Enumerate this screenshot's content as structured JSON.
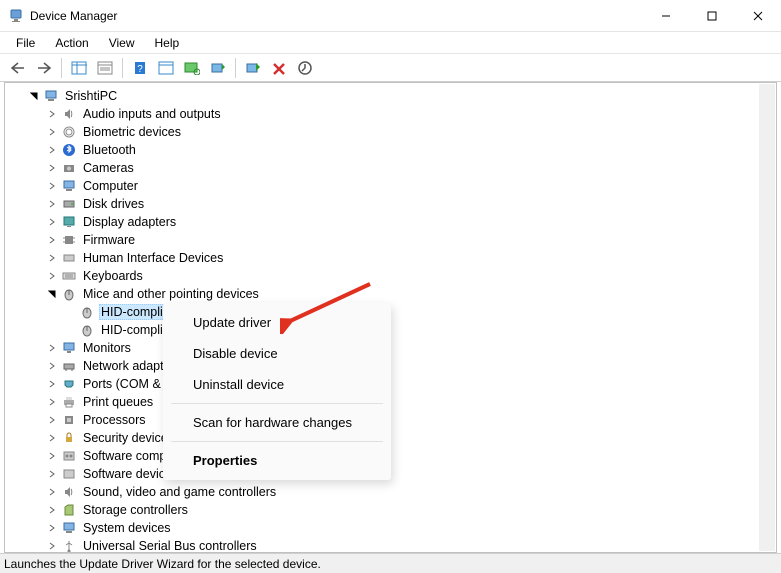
{
  "window": {
    "title": "Device Manager"
  },
  "menu": {
    "file": "File",
    "action": "Action",
    "view": "View",
    "help": "Help"
  },
  "tree": {
    "root": "SrishtiPC",
    "categories": [
      "Audio inputs and outputs",
      "Biometric devices",
      "Bluetooth",
      "Cameras",
      "Computer",
      "Disk drives",
      "Display adapters",
      "Firmware",
      "Human Interface Devices",
      "Keyboards",
      "Mice and other pointing devices",
      "Monitors",
      "Network adapters",
      "Ports (COM & LP",
      "Print queues",
      "Processors",
      "Security devices",
      "Software components",
      "Software devices",
      "Sound, video and game controllers",
      "Storage controllers",
      "System devices",
      "Universal Serial Bus controllers"
    ],
    "mice_children": [
      "HID-complian",
      "HID-complian"
    ]
  },
  "context_menu": {
    "update": "Update driver",
    "disable": "Disable device",
    "uninstall": "Uninstall device",
    "scan": "Scan for hardware changes",
    "properties": "Properties"
  },
  "status": "Launches the Update Driver Wizard for the selected device."
}
